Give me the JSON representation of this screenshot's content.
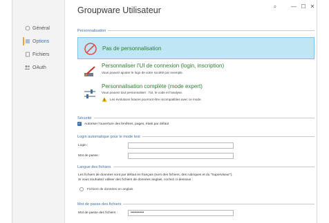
{
  "window": {
    "title": "Groupware Utilisateur",
    "controls": {
      "search": "⌕",
      "minimize": "—",
      "maximize": "☐",
      "close": "✕"
    }
  },
  "sidebar": {
    "items": [
      {
        "label": "Général",
        "icon": "circle-icon"
      },
      {
        "label": "Options",
        "icon": "list-icon",
        "active": true
      },
      {
        "label": "Fichiers",
        "icon": "file-icon"
      },
      {
        "label": "OAuth",
        "icon": "users-icon"
      }
    ]
  },
  "personnalisation": {
    "section_label": "Personnalisation",
    "options": [
      {
        "title": "Pas de personnalisation",
        "selected": true
      },
      {
        "title": "Personnaliser l'UI de connexion (login, inscription)",
        "desc": "Vous pouvez ajouter le logo de votre société par exemple."
      },
      {
        "title": "Personnalisation complète (mode expert)",
        "desc": "Vous pouvez tout personnaliser : l'UI, le code et l'analyse.",
        "warning": "Les évolutions futures pourront être incompatibles avec ce mode."
      }
    ]
  },
  "securite": {
    "section_label": "Sécurité",
    "checkbox_label": "Autoriser l'ouverture des fenêtres, pages, états par défaut",
    "checked": true
  },
  "login_auto": {
    "section_label": "Login automatique pour le mode test",
    "login_label": "Login :",
    "login_value": "",
    "password_label": "Mot de passe :",
    "password_value": ""
  },
  "langue": {
    "section_label": "Langue des fichiers",
    "text1": "Les fichiers de données sont par défaut en français (nom des fichiers, des rubriques et du \"Superviseur\").",
    "text2": "Si vous souhaitez utiliser des fichiers de données anglais, cochez ci-dessous :",
    "radio_label": "Fichiers de données en anglais"
  },
  "mdp_fichiers": {
    "section_label": "Mot de passe des fichiers",
    "field_label": "Mot de passe des fichiers :",
    "field_value": "•••••••••••"
  },
  "colors": {
    "accent": "#3d6fae",
    "selected_bg": "#bfe6f4",
    "option_title": "#2e7d32",
    "active_marker": "#f2a33a"
  }
}
